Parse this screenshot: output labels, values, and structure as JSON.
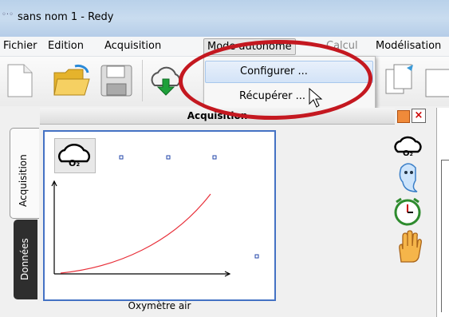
{
  "window": {
    "title": "sans nom 1 - Redy"
  },
  "menubar": {
    "items": [
      {
        "label": "Fichier"
      },
      {
        "label": "Edition"
      },
      {
        "label": "Acquisition"
      },
      {
        "label": "Mode autonome"
      },
      {
        "label": "Calcul"
      },
      {
        "label": "Modélisation"
      }
    ]
  },
  "dropdown": {
    "items": [
      {
        "label": "Configurer ..."
      },
      {
        "label": "Récupérer ..."
      }
    ]
  },
  "side_tabs": [
    {
      "label": "Acquisition"
    },
    {
      "label": "Données"
    }
  ],
  "panel": {
    "header": "Acquisition",
    "sensor_name": "Oxymètre air",
    "sensor_icon_text": "O₂"
  },
  "right_icons": [
    "o2-sensor-icon",
    "ghost-icon",
    "clock-icon",
    "hand-icon"
  ],
  "toolbar_icons": [
    "new-document-icon",
    "open-folder-icon",
    "save-icon",
    "download-cloud-icon",
    "copy-icon",
    "paste-icon"
  ],
  "colors": {
    "accent_border": "#4472c4",
    "highlight_ellipse": "#c41820",
    "curve": "#e8303a",
    "minimize_btn": "#f08a3a"
  }
}
